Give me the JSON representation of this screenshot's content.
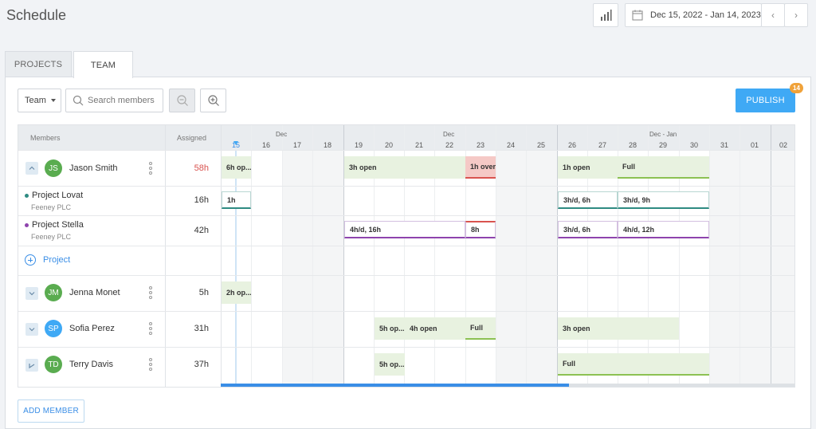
{
  "header": {
    "title": "Schedule",
    "date_range": "Dec 15, 2022 - Jan 14, 2023",
    "prev_icon": "‹",
    "next_icon": "›"
  },
  "tabs": [
    {
      "label": "PROJECTS",
      "active": false
    },
    {
      "label": "TEAM",
      "active": true
    }
  ],
  "toolbar": {
    "team_filter": "Team",
    "search_placeholder": "Search members",
    "publish_label": "PUBLISH",
    "publish_count": "14"
  },
  "grid": {
    "col_members": "Members",
    "col_assigned": "Assigned",
    "months": [
      "Dec",
      "Dec",
      "Dec - Jan"
    ],
    "days": [
      "15",
      "16",
      "17",
      "18",
      "19",
      "20",
      "21",
      "22",
      "23",
      "24",
      "25",
      "26",
      "27",
      "28",
      "29",
      "30",
      "31",
      "01",
      "02"
    ],
    "today": "15"
  },
  "rows": [
    {
      "type": "member",
      "initials": "JS",
      "name": "Jason Smith",
      "assigned": "58h",
      "avatar_color": "#5aac50",
      "assigned_color": "#d9534f"
    },
    {
      "type": "project",
      "name": "Project Lovat",
      "client": "Feeney PLC",
      "assigned": "16h",
      "dot_color": "#2e8b82"
    },
    {
      "type": "project",
      "name": "Project Stella",
      "client": "Feeney PLC",
      "assigned": "42h",
      "dot_color": "#8e44ad"
    },
    {
      "type": "add",
      "label": "Project"
    },
    {
      "type": "member",
      "initials": "JM",
      "name": "Jenna Monet",
      "assigned": "5h",
      "avatar_color": "#5aac50"
    },
    {
      "type": "member",
      "initials": "SP",
      "name": "Sofia Perez",
      "assigned": "31h",
      "avatar_color": "#3fa9f5"
    },
    {
      "type": "member",
      "initials": "TD",
      "name": "Terry Davis",
      "assigned": "37h",
      "avatar_color": "#5aac50"
    }
  ],
  "bars": {
    "js_1": "6h op...",
    "js_2": "3h open",
    "js_3": "1h over",
    "js_4": "1h open",
    "js_5": "Full",
    "pl_1": "1h",
    "pl_2": "3h/d, 6h",
    "pl_3": "3h/d, 9h",
    "ps_1": "4h/d, 16h",
    "ps_2": "8h",
    "ps_3": "3h/d, 6h",
    "ps_4": "4h/d, 12h",
    "jm_1": "2h op...",
    "sp_1": "5h op...",
    "sp_2": "4h open",
    "sp_3": "Full",
    "sp_4": "3h open",
    "td_1": "5h op...",
    "td_2": "Full"
  },
  "footer": {
    "add_member": "ADD MEMBER"
  },
  "colors": {
    "accent": "#3fa9f5",
    "publish_badge": "#f0a23a"
  }
}
